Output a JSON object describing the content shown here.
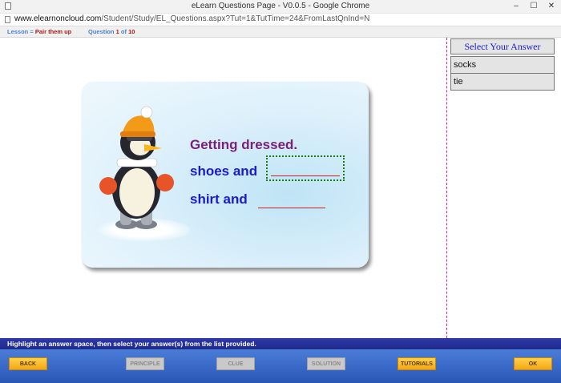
{
  "window": {
    "title": "eLearn Questions Page - V0.0.5 - Google Chrome",
    "controls": [
      "–",
      "☐",
      "✕"
    ]
  },
  "address": {
    "domain": "www.elearnoncloud.com",
    "path": "/Student/Study/EL_Questions.aspx?Tut=1&TutTime=24&FromLastQnInd=N"
  },
  "lesson": {
    "label": "Lesson",
    "sep": "=",
    "name": "Pair them up",
    "question_label": "Question",
    "current": "1",
    "of": "of",
    "total": "10"
  },
  "card": {
    "heading": "Getting dressed.",
    "line1": "shoes and",
    "line2": "shirt and"
  },
  "answers": {
    "heading": "Select Your Answer",
    "items": [
      "socks",
      "tie"
    ]
  },
  "instruction": "Highlight an answer space, then select your answer(s) from the list provided.",
  "buttons": {
    "back": "BACK",
    "principle": "PRINCIPLE",
    "clue": "CLUE",
    "solution": "SOLUTION",
    "tutorials": "TUTORIALS",
    "ok": "OK"
  },
  "colors": {
    "heading": "#7a1f7a",
    "sentence": "#1a1acc",
    "instruction_bar": "#2c39a8",
    "active_button": "#f3a615",
    "divider": "#e020b0"
  }
}
